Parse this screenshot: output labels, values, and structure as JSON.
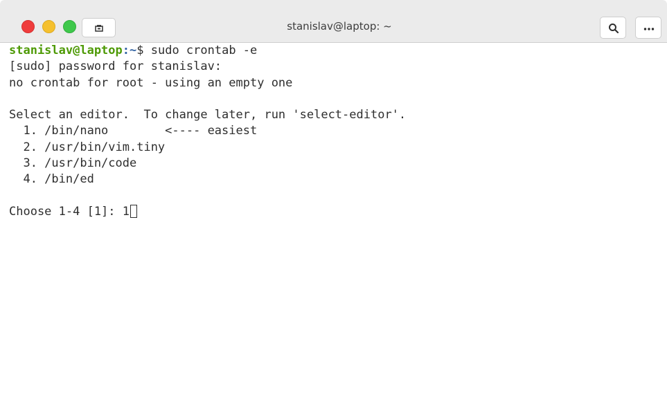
{
  "window": {
    "title": "stanislav@laptop: ~",
    "buttons": {
      "close": "close",
      "minimize": "minimize",
      "maximize": "maximize",
      "new_tab_icon": "new-tab-icon",
      "search_icon": "search-icon",
      "menu_icon": "more-icon"
    }
  },
  "terminal": {
    "prompt_user": "stanislav@laptop",
    "prompt_path": ":~",
    "prompt_symbol": "$ ",
    "command": "sudo crontab -e",
    "lines": [
      "[sudo] password for stanislav:",
      "no crontab for root - using an empty one",
      "",
      "Select an editor.  To change later, run 'select-editor'.",
      "  1. /bin/nano        <---- easiest",
      "  2. /usr/bin/vim.tiny",
      "  3. /usr/bin/code",
      "  4. /bin/ed",
      "",
      "Choose 1-4 [1]: 1"
    ]
  },
  "colors": {
    "prompt_user": "#4e9a06",
    "prompt_path": "#3465a4",
    "text": "#2e2e2e",
    "close": "#ef3c3c",
    "minimize": "#f5c02e",
    "maximize": "#3fc84b"
  }
}
